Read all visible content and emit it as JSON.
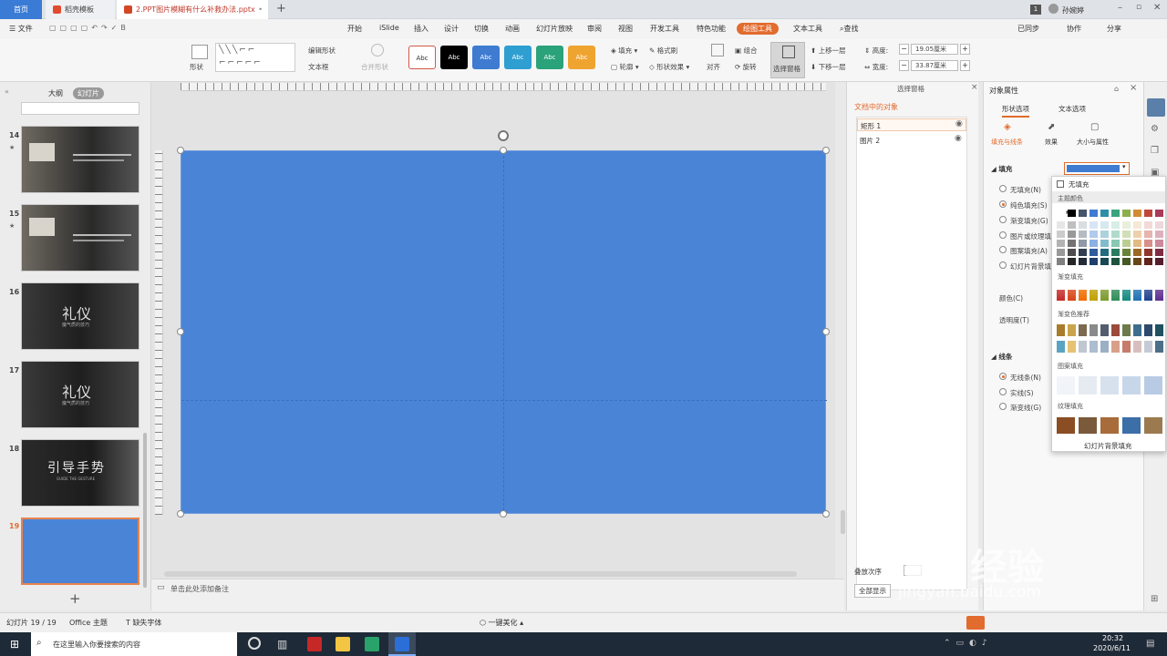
{
  "tabs": {
    "home": "首页",
    "template": "稻壳模板",
    "file": "2.PPT图片模糊有什么补救办法.pptx"
  },
  "window": {
    "page_num": "1",
    "user": "孙婉婷"
  },
  "menu": {
    "file": "文件",
    "items": [
      "开始",
      "iSlide",
      "插入",
      "设计",
      "切换",
      "动画",
      "幻灯片放映",
      "审阅",
      "视图",
      "开发工具",
      "特色功能"
    ],
    "active": "绘图工具",
    "text_tools": "文本工具",
    "search": "查找",
    "sync": "已同步",
    "collab": "协作",
    "share": "分享"
  },
  "ribbon": {
    "shape": "形状",
    "edit_shape": "编辑形状",
    "textbox": "文本框",
    "merge_shape": "合并形状",
    "style_label": "Abc",
    "fill": "填充",
    "format_brush": "格式刷",
    "outline": "轮廓",
    "shape_effect": "形状效果",
    "align": "对齐",
    "group": "组合",
    "rotate": "旋转",
    "select_pane": "选择窗格",
    "bring_forward": "上移一层",
    "send_backward": "下移一层",
    "height_label": "高度:",
    "height_value": "19.05厘米",
    "width_label": "宽度:",
    "width_value": "33.87厘米"
  },
  "thumbs": {
    "outline_tab": "大纲",
    "slides_tab": "幻灯片",
    "slides": [
      {
        "num": "14",
        "star": "★"
      },
      {
        "num": "15",
        "star": "★"
      },
      {
        "num": "16",
        "title": "礼仪",
        "sub": "魔气质的技巧"
      },
      {
        "num": "17",
        "title": "礼仪",
        "sub": "魔气质的技巧"
      },
      {
        "num": "18",
        "title": "引导手势",
        "sub": "GUIDE THE GESTURE"
      },
      {
        "num": "19"
      }
    ],
    "add": "+"
  },
  "notes": {
    "placeholder": "单击此处添加备注"
  },
  "selection_pane": {
    "title": "选择窗格",
    "section": "文档中的对象",
    "items": [
      "矩形 1",
      "图片 2"
    ],
    "order_label": "叠放次序",
    "show_all": "全部显示"
  },
  "properties": {
    "title": "对象属性",
    "tab_shape": "形状选项",
    "tab_text": "文本选项",
    "sub_fill": "填充与线条",
    "sub_effect": "效果",
    "sub_size": "大小与属性",
    "fill_header": "填充",
    "fill_options": [
      "无填充(N)",
      "纯色填充(S)",
      "渐变填充(G)",
      "图片或纹理填充",
      "图案填充(A)",
      "幻灯片背景填充"
    ],
    "color_label": "颜色(C)",
    "transparency_label": "透明度(T)",
    "line_header": "线条",
    "line_options": [
      "无线条(N)",
      "实线(S)",
      "渐变线(G)"
    ]
  },
  "popup": {
    "no_fill": "无填充",
    "theme_colors": "主题颜色",
    "gradient_fill": "渐变填充",
    "gradient_recommend": "渐变色推荐",
    "pattern_fill": "图案填充",
    "texture_fill": "纹理填充",
    "slide_bg_fill": "幻灯片背景填充"
  },
  "status": {
    "slide_count": "幻灯片 19 / 19",
    "theme": "Office 主题",
    "missing_font": "缺失字体",
    "beautify": "一键美化"
  },
  "taskbar": {
    "search": "在这里输入你要搜索的内容",
    "time": "20:32",
    "date": "2020/6/11"
  },
  "watermark": {
    "brand": "Bai经验",
    "url": "jingyan.baidu.com"
  },
  "colors": {
    "accent": "#e26b2e",
    "slide_fill": "#4a84d6"
  }
}
